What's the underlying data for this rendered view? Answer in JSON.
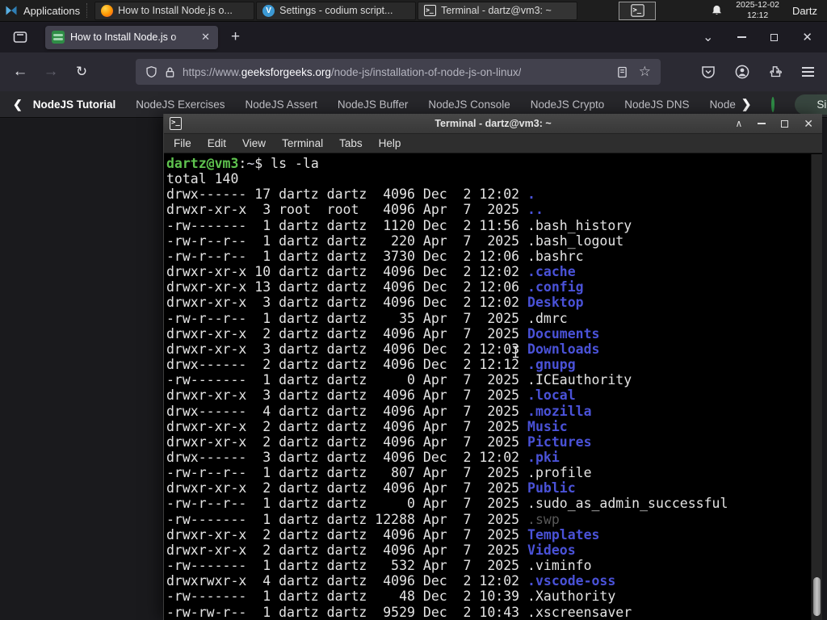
{
  "colors": {
    "gfg_green": "#2f8d46",
    "terminal_prompt_green": "#5ec24e",
    "terminal_dir_blue": "#4a52d8",
    "firefox_orange": "#ff9500",
    "vscodium_blue": "#3c99d4"
  },
  "glyphs": {
    "back": "←",
    "forward": "→",
    "reload": "↻",
    "star": "☆",
    "new_tab": "+",
    "list_tabs": "⌄",
    "close": "✕",
    "shade": "∧",
    "chevron_left": "❮",
    "chevron_right": "❯",
    "terminal_prompt": ">_"
  },
  "panel": {
    "applications_label": "Applications",
    "window_buttons": [
      {
        "label": "How to Install Node.js o...",
        "icon": "firefox"
      },
      {
        "label": "Settings - codium script...",
        "icon": "vscodium"
      },
      {
        "label": "Terminal - dartz@vm3: ~",
        "icon": "terminal"
      }
    ],
    "clock_date": "2025-12-02",
    "clock_time": "12:12",
    "user": "Dartz"
  },
  "browser": {
    "tab": {
      "title": "How to Install Node.js o"
    },
    "url": {
      "scheme_www": "https://www.",
      "domain": "geeksforgeeks.org",
      "path": "/node-js/installation-of-node-js-on-linux/"
    },
    "nav_links": [
      "NodeJS Tutorial",
      "NodeJS Exercises",
      "NodeJS Assert",
      "NodeJS Buffer",
      "NodeJS Console",
      "NodeJS Crypto",
      "NodeJS DNS",
      "Node"
    ],
    "sign_in_label": "Sign In"
  },
  "terminal": {
    "title": "Terminal - dartz@vm3: ~",
    "menus": [
      "File",
      "Edit",
      "View",
      "Terminal",
      "Tabs",
      "Help"
    ],
    "prompt": {
      "user_host": "dartz@vm3",
      "colon": ":",
      "path": "~",
      "dollar_cmd": "$ ls -la"
    },
    "total_line": "total 140",
    "listing": [
      [
        "drwx------",
        "17",
        "dartz",
        "dartz",
        "4096",
        "Dec  2 12:02",
        ".",
        "dir"
      ],
      [
        "drwxr-xr-x",
        "3",
        "root",
        "root",
        "4096",
        "Apr  7  2025",
        "..",
        "dir"
      ],
      [
        "-rw-------",
        "1",
        "dartz",
        "dartz",
        "1120",
        "Dec  2 11:56",
        ".bash_history",
        "file"
      ],
      [
        "-rw-r--r--",
        "1",
        "dartz",
        "dartz",
        "220",
        "Apr  7  2025",
        ".bash_logout",
        "file"
      ],
      [
        "-rw-r--r--",
        "1",
        "dartz",
        "dartz",
        "3730",
        "Dec  2 12:06",
        ".bashrc",
        "file"
      ],
      [
        "drwxr-xr-x",
        "10",
        "dartz",
        "dartz",
        "4096",
        "Dec  2 12:02",
        ".cache",
        "dir"
      ],
      [
        "drwxr-xr-x",
        "13",
        "dartz",
        "dartz",
        "4096",
        "Dec  2 12:06",
        ".config",
        "dir"
      ],
      [
        "drwxr-xr-x",
        "3",
        "dartz",
        "dartz",
        "4096",
        "Dec  2 12:02",
        "Desktop",
        "dir"
      ],
      [
        "-rw-r--r--",
        "1",
        "dartz",
        "dartz",
        "35",
        "Apr  7  2025",
        ".dmrc",
        "file"
      ],
      [
        "drwxr-xr-x",
        "2",
        "dartz",
        "dartz",
        "4096",
        "Apr  7  2025",
        "Documents",
        "dir"
      ],
      [
        "drwxr-xr-x",
        "3",
        "dartz",
        "dartz",
        "4096",
        "Dec  2 12:03",
        "Downloads",
        "dir"
      ],
      [
        "drwx------",
        "2",
        "dartz",
        "dartz",
        "4096",
        "Dec  2 12:12",
        ".gnupg",
        "dir"
      ],
      [
        "-rw-------",
        "1",
        "dartz",
        "dartz",
        "0",
        "Apr  7  2025",
        ".ICEauthority",
        "file"
      ],
      [
        "drwxr-xr-x",
        "3",
        "dartz",
        "dartz",
        "4096",
        "Apr  7  2025",
        ".local",
        "dir"
      ],
      [
        "drwx------",
        "4",
        "dartz",
        "dartz",
        "4096",
        "Apr  7  2025",
        ".mozilla",
        "dir"
      ],
      [
        "drwxr-xr-x",
        "2",
        "dartz",
        "dartz",
        "4096",
        "Apr  7  2025",
        "Music",
        "dir"
      ],
      [
        "drwxr-xr-x",
        "2",
        "dartz",
        "dartz",
        "4096",
        "Apr  7  2025",
        "Pictures",
        "dir"
      ],
      [
        "drwx------",
        "3",
        "dartz",
        "dartz",
        "4096",
        "Dec  2 12:02",
        ".pki",
        "dir"
      ],
      [
        "-rw-r--r--",
        "1",
        "dartz",
        "dartz",
        "807",
        "Apr  7  2025",
        ".profile",
        "file"
      ],
      [
        "drwxr-xr-x",
        "2",
        "dartz",
        "dartz",
        "4096",
        "Apr  7  2025",
        "Public",
        "dir"
      ],
      [
        "-rw-r--r--",
        "1",
        "dartz",
        "dartz",
        "0",
        "Apr  7  2025",
        ".sudo_as_admin_successful",
        "file"
      ],
      [
        "-rw-------",
        "1",
        "dartz",
        "dartz",
        "12288",
        "Apr  7  2025",
        ".swp",
        "dim"
      ],
      [
        "drwxr-xr-x",
        "2",
        "dartz",
        "dartz",
        "4096",
        "Apr  7  2025",
        "Templates",
        "dir"
      ],
      [
        "drwxr-xr-x",
        "2",
        "dartz",
        "dartz",
        "4096",
        "Apr  7  2025",
        "Videos",
        "dir"
      ],
      [
        "-rw-------",
        "1",
        "dartz",
        "dartz",
        "532",
        "Apr  7  2025",
        ".viminfo",
        "file"
      ],
      [
        "drwxrwxr-x",
        "4",
        "dartz",
        "dartz",
        "4096",
        "Dec  2 12:02",
        ".vscode-oss",
        "dir"
      ],
      [
        "-rw-------",
        "1",
        "dartz",
        "dartz",
        "48",
        "Dec  2 10:39",
        ".Xauthority",
        "file"
      ],
      [
        "-rw-rw-r--",
        "1",
        "dartz",
        "dartz",
        "9529",
        "Dec  2 10:43",
        ".xscreensaver",
        "file"
      ]
    ]
  }
}
